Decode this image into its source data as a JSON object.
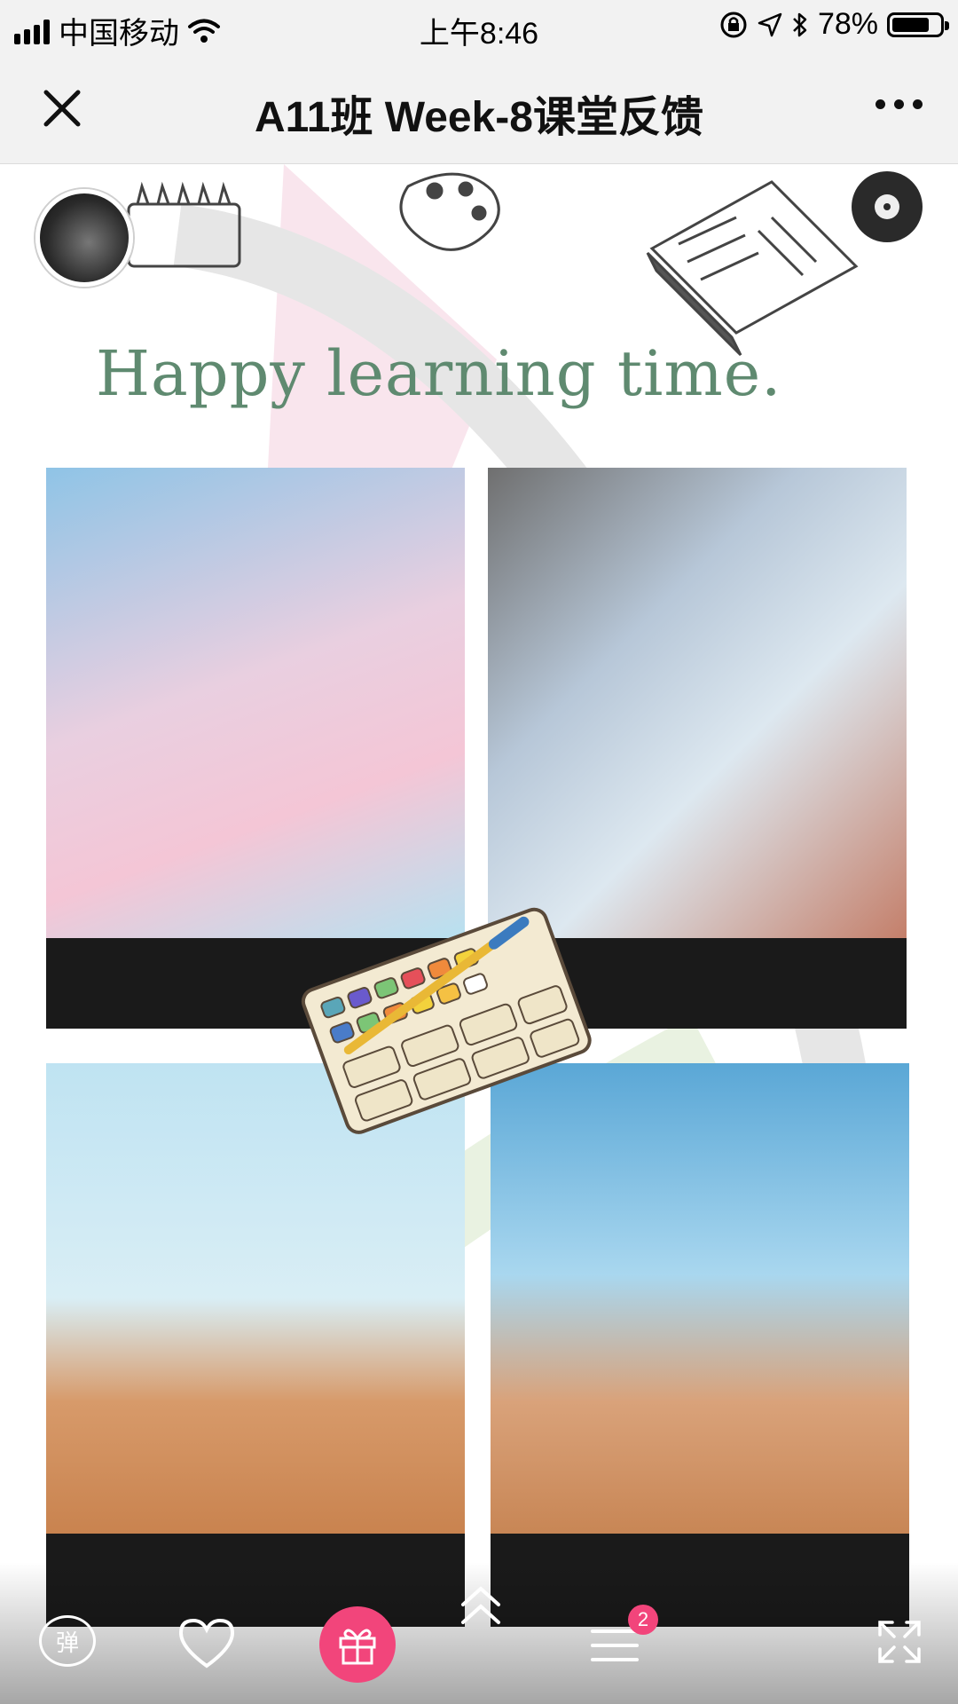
{
  "status_bar": {
    "carrier": "中国移动",
    "time": "上午8:46",
    "battery_percent": "78%",
    "battery_level": 0.78
  },
  "nav": {
    "title": "A11班 Week-8课堂反馈"
  },
  "content": {
    "headline": "Happy learning time.",
    "photos": [
      {
        "name": "photo-1"
      },
      {
        "name": "photo-2"
      },
      {
        "name": "photo-3"
      },
      {
        "name": "photo-4"
      }
    ]
  },
  "toolbar": {
    "danmu_label": "弹",
    "menu_badge_count": "2"
  },
  "colors": {
    "headline": "#5f8a70",
    "gift_pink": "#f2457b",
    "nav_bg": "#f2f2f2"
  },
  "icons": [
    "signal-icon",
    "wifi-icon",
    "lock-rotation-icon",
    "location-icon",
    "bluetooth-icon",
    "battery-icon",
    "close-icon",
    "more-icon",
    "heart-icon",
    "gift-icon",
    "double-chevron-up-icon",
    "menu-icon",
    "fullscreen-icon"
  ]
}
